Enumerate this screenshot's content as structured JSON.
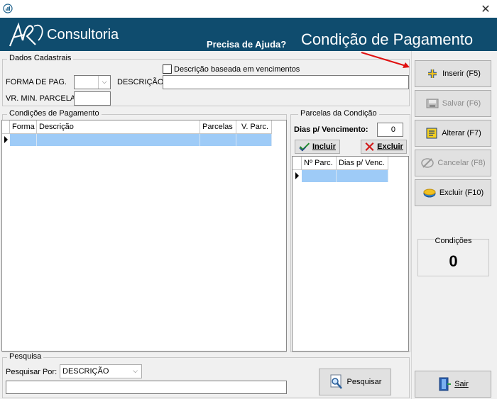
{
  "window": {
    "close_glyph": "✕"
  },
  "header": {
    "brand": "Consultoria",
    "help_link": "Precisa de Ajuda?",
    "title": "Condição de Pagamento",
    "colors": {
      "header_bg": "#0f4c6e",
      "selection": "#9ecbf7",
      "arrow": "#e01010"
    }
  },
  "dados_cadastrais": {
    "title": "Dados Cadastrais",
    "checkbox_label": "Descrição baseada em vencimentos",
    "checkbox_checked": false,
    "forma_pag_label": "FORMA DE PAG.",
    "forma_pag_value": "",
    "descricao_label": "DESCRIÇÃO",
    "descricao_value": "",
    "vr_min_label": "VR. MIN. PARCELA",
    "vr_min_value": ""
  },
  "condicoes": {
    "title": "Condições de Pagamento",
    "columns": [
      "Forma",
      "Descrição",
      "Parcelas",
      "V. Parc."
    ],
    "rows": [
      [
        "",
        "",
        "",
        ""
      ]
    ]
  },
  "parcelas": {
    "title": "Parcelas da Condição",
    "dias_label": "Dias p/ Vencimento:",
    "dias_value": "0",
    "incluir_label": "Incluir",
    "excluir_label": "Excluir",
    "columns": [
      "Nº Parc.",
      "Dias p/ Venc."
    ],
    "rows": [
      [
        "",
        ""
      ]
    ]
  },
  "pesquisa": {
    "title": "Pesquisa",
    "por_label": "Pesquisar Por:",
    "por_value": "DESCRIÇÃO",
    "search_value": "",
    "button_label": "Pesquisar"
  },
  "sidebar": {
    "inserir": "Inserir (F5)",
    "salvar": "Salvar (F6)",
    "alterar": "Alterar (F7)",
    "cancelar": "Cancelar (F8)",
    "excluir": "Excluir (F10)",
    "counter_label": "Condições",
    "counter_value": "0",
    "sair": "Sair"
  },
  "icons": [
    "app-icon",
    "logo-mark",
    "close-icon",
    "chevron-down-icon",
    "check-icon",
    "x-icon",
    "plus-icon",
    "save-icon",
    "edit-icon",
    "cancel-icon",
    "delete-icon",
    "search-icon",
    "exit-door-icon"
  ]
}
